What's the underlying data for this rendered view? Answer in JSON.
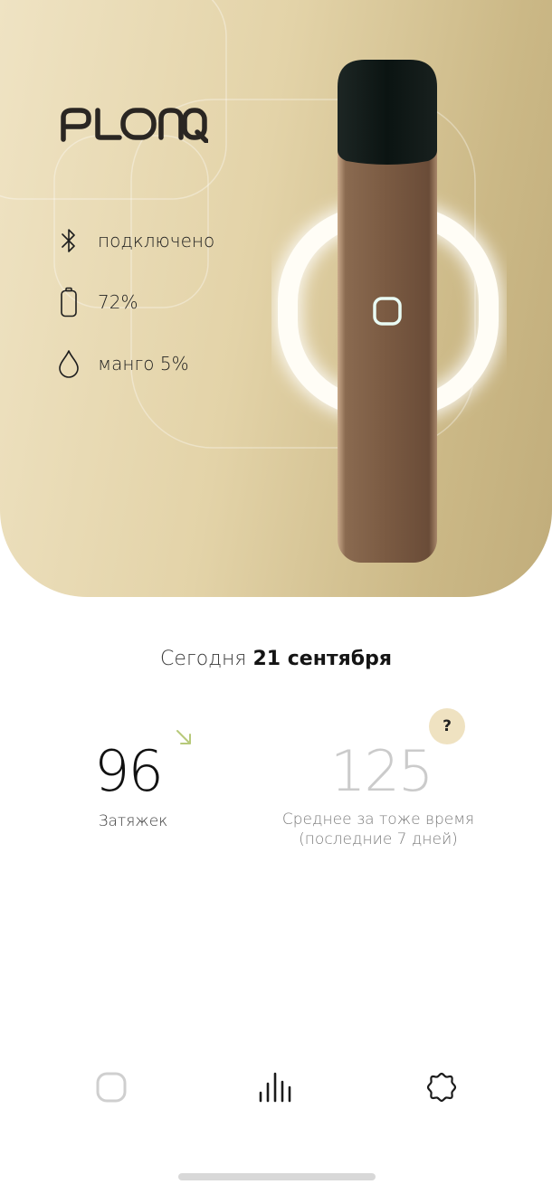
{
  "brand": {
    "logo_text": "PLONQ"
  },
  "device_status": {
    "connection": {
      "icon": "bluetooth-icon",
      "label": "подключено"
    },
    "battery": {
      "icon": "battery-icon",
      "label": "72%",
      "level_percent": 72
    },
    "liquid": {
      "icon": "drop-icon",
      "label": "манго 5%"
    }
  },
  "date": {
    "prefix": "Сегодня",
    "value": "21 сентября"
  },
  "metrics": {
    "puffs": {
      "value": "96",
      "label": "Затяжек",
      "trend": "down",
      "trend_color": "#b7c97a"
    },
    "average": {
      "value": "125",
      "label_line1": "Среднее за тоже время",
      "label_line2": "(последние 7 дней)"
    },
    "help_button_label": "?"
  },
  "nav": [
    {
      "name": "device",
      "icon": "device-square-icon",
      "active": false
    },
    {
      "name": "stats",
      "icon": "bar-chart-icon",
      "active": true
    },
    {
      "name": "settings",
      "icon": "gear-icon",
      "active": false
    }
  ],
  "colors": {
    "hero_light": "#efe3c3",
    "hero_dark": "#c1ad7b",
    "device_body": "#7a5a42",
    "device_cap": "#0e1614",
    "help_bg": "#efe2c1",
    "muted_value": "#cbcbcb"
  }
}
